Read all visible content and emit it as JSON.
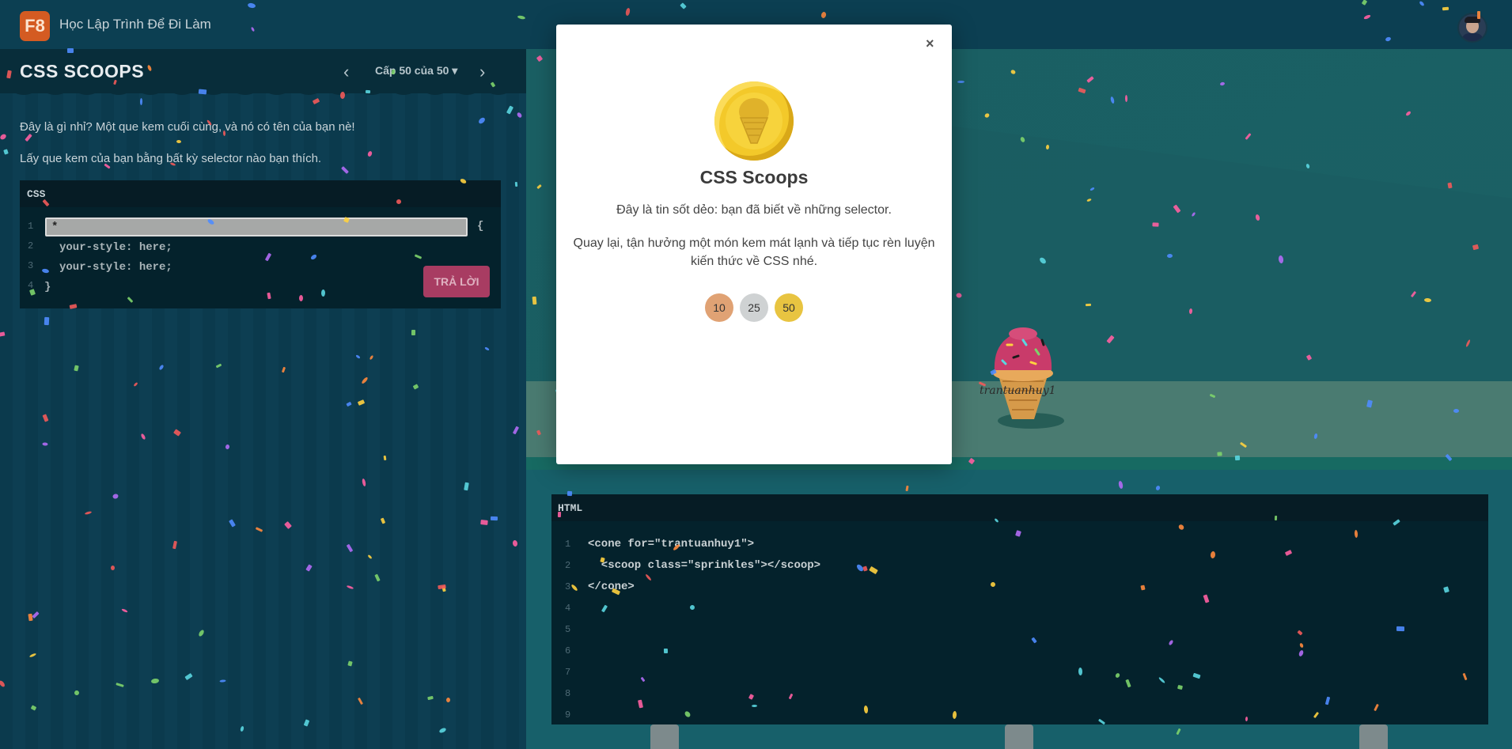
{
  "app": {
    "logo_text": "F8",
    "brand_text": "Học Lập Trình Để Đi Làm"
  },
  "game": {
    "title": "CSS SCOOPS",
    "prev_icon": "‹",
    "next_icon": "›",
    "level_label": "Cấp 50 của 50 ▾",
    "instructions": [
      "Đây là gì nhỉ? Một que kem cuối cùng, và nó có tên của bạn nè!",
      "Lấy que kem của bạn bằng bất kỳ selector nào bạn thích."
    ]
  },
  "css_editor": {
    "label": "CSS",
    "line_numbers": [
      "1",
      "2",
      "3",
      "4"
    ],
    "input_value": "*",
    "open_brace": "{",
    "lines": [
      "your-style: here;",
      "your-style: here;"
    ],
    "close_brace": "}",
    "answer_button": "TRẢ LỜI"
  },
  "scene": {
    "player_name": "trantuanhuy1"
  },
  "html_viewer": {
    "label": "HTML",
    "line_numbers": [
      "1",
      "2",
      "3",
      "4",
      "5",
      "6",
      "7",
      "8",
      "9"
    ],
    "lines": [
      "<cone for=\"trantuanhuy1\">",
      "  <scoop class=\"sprinkles\"></scoop>",
      "</cone>"
    ]
  },
  "modal": {
    "close_label": "×",
    "title": "CSS Scoops",
    "text1": "Đây là tin sốt dẻo: bạn đã biết về những selector.",
    "text2": "Quay lại, tận hưởng một món kem mát lạnh và tiếp tục rèn luyện kiến thức về CSS nhé.",
    "badges": [
      {
        "label": "10",
        "color": "#e0a274"
      },
      {
        "label": "25",
        "color": "#cfd2d3"
      },
      {
        "label": "50",
        "color": "#e8c441"
      }
    ]
  },
  "colors": {
    "accent": "#d45b22",
    "answer_button": "#a83c62",
    "background": "#0b3a4a"
  }
}
